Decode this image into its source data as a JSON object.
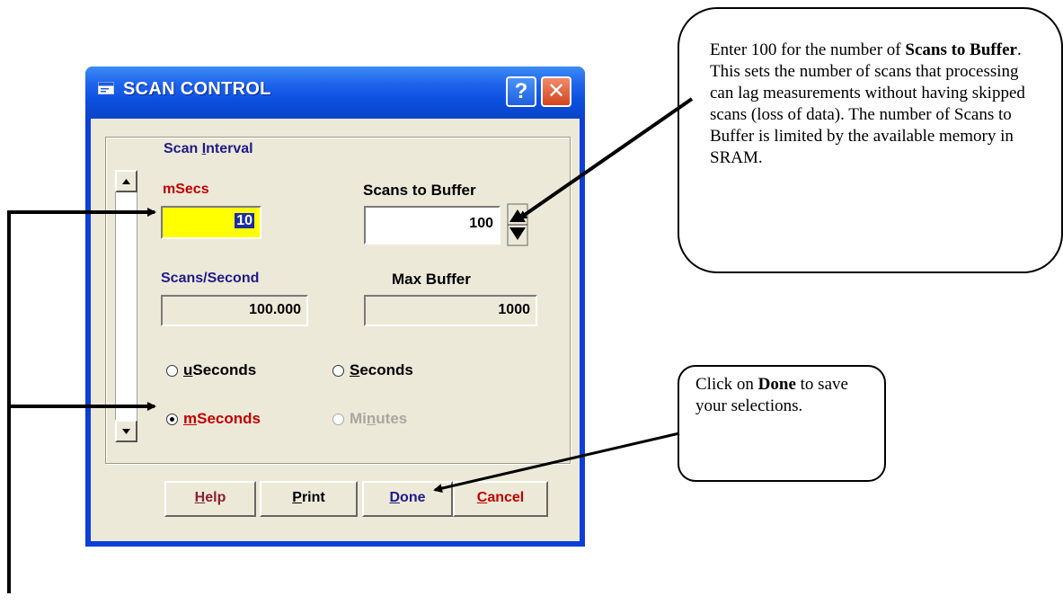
{
  "window": {
    "title": "SCAN CONTROL",
    "help_glyph": "?",
    "close_glyph": "✕"
  },
  "scan_interval": {
    "group_label_pre": "Scan ",
    "group_label_u": "I",
    "group_label_post": "nterval",
    "msecs_label": "mSecs",
    "msecs_value": "10",
    "scans_to_buffer_label": "Scans to Buffer",
    "scans_to_buffer_value": "100",
    "scans_per_second_label": "Scans/Second",
    "scans_per_second_value": "100.000",
    "max_buffer_label": "Max Buffer",
    "max_buffer_value": "1000"
  },
  "units": {
    "useconds_u": "u",
    "useconds_rest": "Seconds",
    "seconds_u": "S",
    "seconds_rest": "econds",
    "mseconds_u": "m",
    "mseconds_rest": "Seconds",
    "minutes_pre": "Mi",
    "minutes_u": "n",
    "minutes_rest": "utes",
    "selected": "mSeconds"
  },
  "buttons": {
    "help_u": "H",
    "help_rest": "elp",
    "print_u": "P",
    "print_rest": "rint",
    "done_u": "D",
    "done_rest": "one",
    "cancel_u": "C",
    "cancel_rest": "ancel"
  },
  "callout_buffer": {
    "t1": "Enter 100 for the number of ",
    "b1": "Scans to Buffer",
    "t2": ".  This sets the number of scans that processing can lag measurements without having skipped scans (loss of data). The number of Scans to Buffer is limited by the available memory in SRAM."
  },
  "callout_done": {
    "t1": "Click on ",
    "b1": "Done",
    "t2": " to save your selections."
  },
  "colors": {
    "title_bar": "#0b4ddc",
    "msecs_field": "#ffff00",
    "label_red": "#c00000",
    "label_navy": "#1f1a8a"
  }
}
